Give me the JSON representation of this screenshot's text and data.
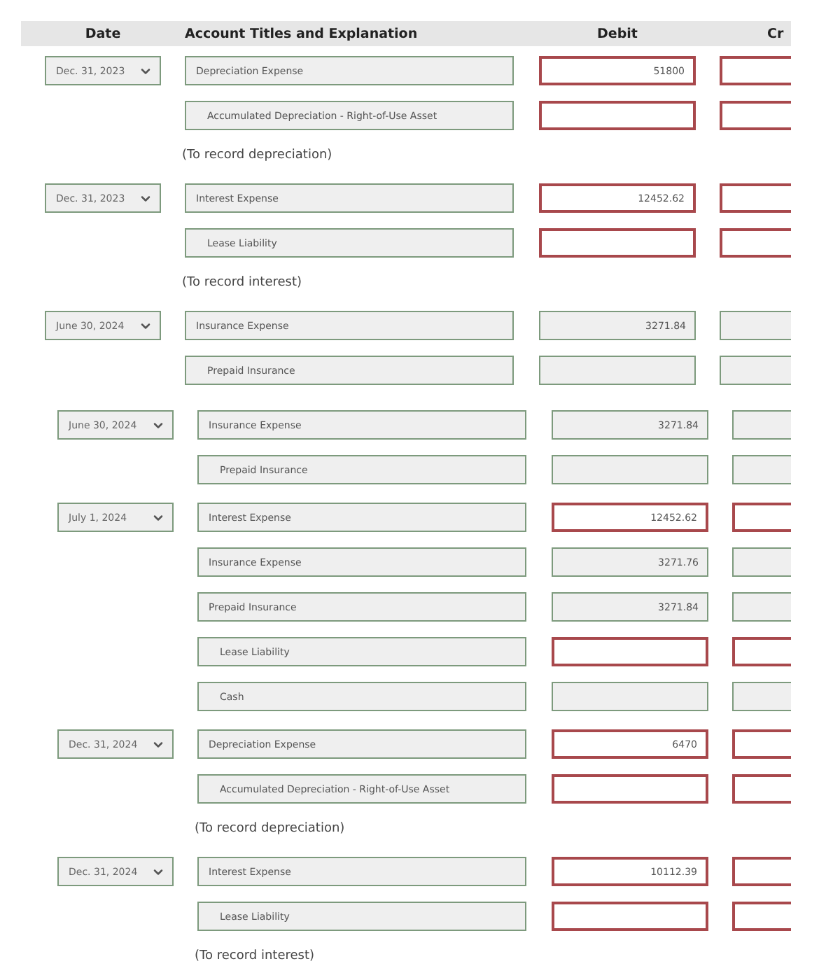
{
  "header": {
    "date": "Date",
    "account": "Account Titles and Explanation",
    "debit": "Debit",
    "credit": "Cr"
  },
  "sections": [
    {
      "entries": [
        {
          "date": "Dec. 31, 2023",
          "lines": [
            {
              "account": "Depreciation Expense",
              "indented": false,
              "debit": {
                "value": "51800",
                "correct": false
              },
              "credit": {
                "correct": false
              }
            },
            {
              "account": "Accumulated Depreciation - Right-of-Use Asset",
              "indented": true,
              "debit": {
                "correct": false
              },
              "credit": {
                "correct": false
              }
            }
          ],
          "note": "(To record depreciation)"
        },
        {
          "date": "Dec. 31, 2023",
          "lines": [
            {
              "account": "Interest Expense",
              "indented": false,
              "debit": {
                "value": "12452.62",
                "correct": false
              },
              "credit": {
                "correct": false
              }
            },
            {
              "account": "Lease Liability",
              "indented": true,
              "debit": {
                "correct": false
              },
              "credit": {
                "correct": false
              }
            }
          ],
          "note": "(To record interest)"
        },
        {
          "date": "June 30, 2024",
          "lines": [
            {
              "account": "Insurance Expense",
              "indented": false,
              "debit": {
                "value": "3271.84",
                "correct": true
              },
              "credit": {
                "correct": true
              }
            },
            {
              "account": "Prepaid Insurance",
              "indented": true,
              "debit": {
                "correct": true
              },
              "credit": {
                "correct": true
              }
            }
          ]
        }
      ]
    },
    {
      "entries": [
        {
          "date": "June 30, 2024",
          "lines": [
            {
              "account": "Insurance Expense",
              "indented": false,
              "debit": {
                "value": "3271.84",
                "correct": true
              },
              "credit": {
                "correct": true
              }
            },
            {
              "account": "Prepaid Insurance",
              "indented": true,
              "debit": {
                "correct": true
              },
              "credit": {
                "correct": true
              }
            }
          ]
        },
        {
          "date": "July 1, 2024",
          "lines": [
            {
              "account": "Interest Expense",
              "indented": false,
              "debit": {
                "value": "12452.62",
                "correct": false
              },
              "credit": {
                "correct": false
              }
            },
            {
              "account": "Insurance Expense",
              "indented": false,
              "debit": {
                "value": "3271.76",
                "correct": true
              },
              "credit": {
                "correct": true
              }
            },
            {
              "account": "Prepaid Insurance",
              "indented": false,
              "debit": {
                "value": "3271.84",
                "correct": true
              },
              "credit": {
                "correct": true
              }
            },
            {
              "account": "Lease Liability",
              "indented": true,
              "debit": {
                "correct": false
              },
              "credit": {
                "correct": false
              }
            },
            {
              "account": "Cash",
              "indented": true,
              "debit": {
                "correct": true
              },
              "credit": {
                "correct": true
              }
            }
          ]
        },
        {
          "date": "Dec. 31, 2024",
          "lines": [
            {
              "account": "Depreciation Expense",
              "indented": false,
              "debit": {
                "value": "6470",
                "correct": false
              },
              "credit": {
                "correct": false
              }
            },
            {
              "account": "Accumulated Depreciation - Right-of-Use Asset",
              "indented": true,
              "debit": {
                "correct": false
              },
              "credit": {
                "correct": false
              }
            }
          ],
          "note": "(To record depreciation)"
        },
        {
          "date": "Dec. 31, 2024",
          "lines": [
            {
              "account": "Interest Expense",
              "indented": false,
              "debit": {
                "value": "10112.39",
                "correct": false
              },
              "credit": {
                "correct": false
              }
            },
            {
              "account": "Lease Liability",
              "indented": true,
              "debit": {
                "correct": false
              },
              "credit": {
                "correct": false
              }
            }
          ],
          "note": "(To record interest)"
        }
      ]
    }
  ]
}
